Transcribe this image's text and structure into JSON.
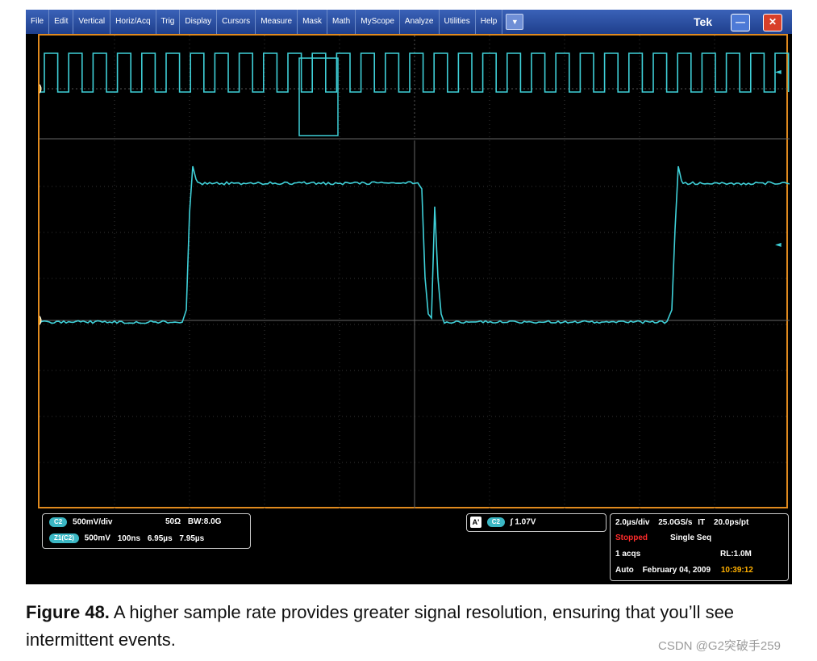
{
  "menu": {
    "items": [
      "File",
      "Edit",
      "Vertical",
      "Horiz/Acq",
      "Trig",
      "Display",
      "Cursors",
      "Measure",
      "Mask",
      "Math",
      "MyScope",
      "Analyze",
      "Utilities",
      "Help"
    ],
    "dropdown_glyph": "▼",
    "brand": "Tek",
    "minimize_glyph": "—",
    "close_glyph": "✕"
  },
  "icons": {
    "minimize": "minimize-icon",
    "close": "close-icon",
    "dropdown": "chevron-down-icon"
  },
  "colors": {
    "trace": "#3fd0d8",
    "border": "#e08a1e",
    "menubar": "#2a4fa6",
    "stopped": "#ff2b2b",
    "time": "#ffb000"
  },
  "markers": {
    "channel_num": "2",
    "arrow": "◄"
  },
  "channel_panel": {
    "c2_badge": "C2",
    "c2_scale": "500mV/div",
    "impedance": "50Ω",
    "bandwidth_label": "BW",
    "bandwidth": "8.0G",
    "z_badge": "Z1(C2)",
    "z_scale": "500mV",
    "z_time": "100ns",
    "z_start": "6.95µs",
    "z_end": "7.95µs"
  },
  "trigger_panel": {
    "a_label": "A'",
    "c2_badge": "C2",
    "slope_glyph": "∫",
    "level": "1.07V"
  },
  "timebase_panel": {
    "time_div": "2.0µs/div",
    "sample_rate": "25.0GS/s",
    "mode": "IT",
    "resolution": "20.0ps/pt",
    "status": "Stopped",
    "seq_mode": "Single Seq",
    "acqs": "1 acqs",
    "record_length": "RL:1.0M",
    "trigger_mode": "Auto",
    "date": "February 04, 2009",
    "time": "10:39:12"
  },
  "caption": {
    "label": "Figure 48.",
    "text": " A higher sample rate provides greater signal resolution, ensuring that you’ll see intermittent events."
  },
  "watermark": "CSDN @G2突破手259"
}
